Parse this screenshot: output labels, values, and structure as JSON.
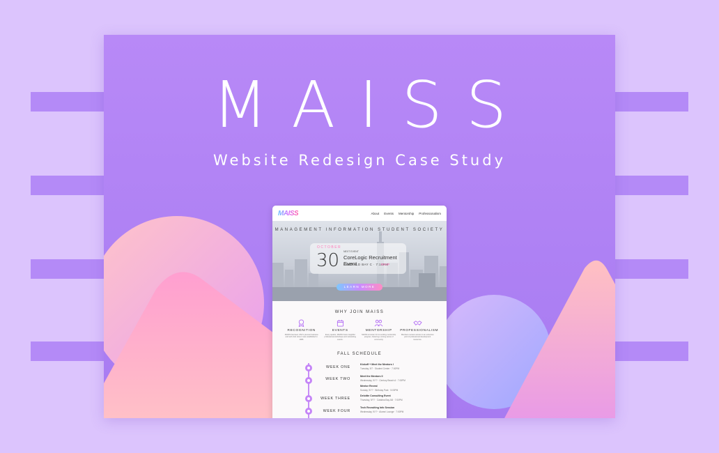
{
  "poster": {
    "title": "MAISS",
    "subtitle": "Website Redesign Case Study"
  },
  "mock": {
    "logo": "MAISS",
    "nav": [
      "About",
      "Events",
      "Mentorship",
      "Professionalism"
    ],
    "society": "MANAGEMENT INFORMATION STUDENT SOCIETY",
    "event": {
      "month": "OCTOBER",
      "day": "30",
      "next_label": "NEXT EVENT",
      "title": "CoreLogic Recruitment Event",
      "location": "EMERALD BAY C · 7:10PM",
      "rsvp": "RSVP"
    },
    "learn_more": "LEARN MORE",
    "why": "WHY JOIN MAISS",
    "features": [
      {
        "label": "RECOGNITION",
        "icon": "award-icon",
        "desc": "MAISS has been USC's premier business and tech club since it was established in 1995."
      },
      {
        "label": "EVENTS",
        "icon": "calendar-icon",
        "desc": "Every quarter, MAISS hosts insightful professional workshops and networking events."
      },
      {
        "label": "MENTORSHIP",
        "icon": "people-icon",
        "desc": "MAISS is known for its exciting mentorship program, fostering a strong sense of community."
      },
      {
        "label": "PROFESSIONALISM",
        "icon": "handshake-icon",
        "desc": "Members receive access to an extensive pool of professional development resources."
      }
    ],
    "fall_schedule": "FALL SCHEDULE",
    "schedule": [
      {
        "week": "WEEK ONE",
        "items": [
          {
            "title": "Kickoff + Meet the Mentors I",
            "detail": "Tuesday, 9/7 · Student Center · 7:00PM"
          }
        ]
      },
      {
        "week": "WEEK TWO",
        "items": [
          {
            "title": "Meet the Mentors II",
            "detail": "Wednesday, 9/?? · Century Beach A · 7:00PM"
          },
          {
            "title": "Mentor Reveal",
            "detail": "Sunday, 9/?? · Birthday Park · 5:00PM"
          }
        ]
      },
      {
        "week": "WEEK THREE",
        "items": [
          {
            "title": "Deloitte Consulting Event",
            "detail": "Thursday, 9/?? · Catalina Bay AB · 7:00PM"
          }
        ]
      },
      {
        "week": "WEEK FOUR",
        "items": [
          {
            "title": "Tech Recruiting Info Session",
            "detail": "Wednesday, 9/?? · Alumni Lounge · 7:00PM"
          }
        ]
      }
    ]
  },
  "colors": {
    "background": "#dcc4fd",
    "poster": "#b088f6",
    "stripe": "#b48af7",
    "accent_pink": "#ff7ab8",
    "accent_purple": "#c585f7"
  }
}
